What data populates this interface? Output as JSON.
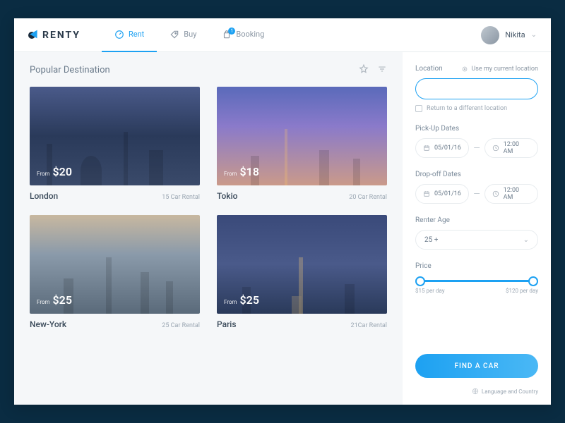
{
  "brand": "RENTY",
  "nav": {
    "rent": "Rent",
    "buy": "Buy",
    "booking": "Booking",
    "booking_badge": "1"
  },
  "user": {
    "name": "Nikita"
  },
  "section": {
    "title": "Popular Destination"
  },
  "cards": [
    {
      "from": "From",
      "price": "$20",
      "city": "London",
      "count": "15 Car Rental"
    },
    {
      "from": "From",
      "price": "$18",
      "city": "Tokio",
      "count": "20 Car Rental"
    },
    {
      "from": "From",
      "price": "$25",
      "city": "New-York",
      "count": "25 Car Rental"
    },
    {
      "from": "From",
      "price": "$25",
      "city": "Paris",
      "count": "21Car Rental"
    }
  ],
  "sidebar": {
    "location_label": "Location",
    "use_location": "Use my current location",
    "location_placeholder": "",
    "diff_location": "Return to a different location",
    "pickup_label": "Pick-Up Dates",
    "dropoff_label": "Drop-off Dates",
    "date": "05/01/16",
    "time": "12:00 AM",
    "age_label": "Renter Age",
    "age_value": "25 +",
    "price_label": "Price",
    "price_min": "$15 per day",
    "price_max": "$120 per day",
    "cta": "FIND A CAR",
    "lang": "Language and Country"
  }
}
